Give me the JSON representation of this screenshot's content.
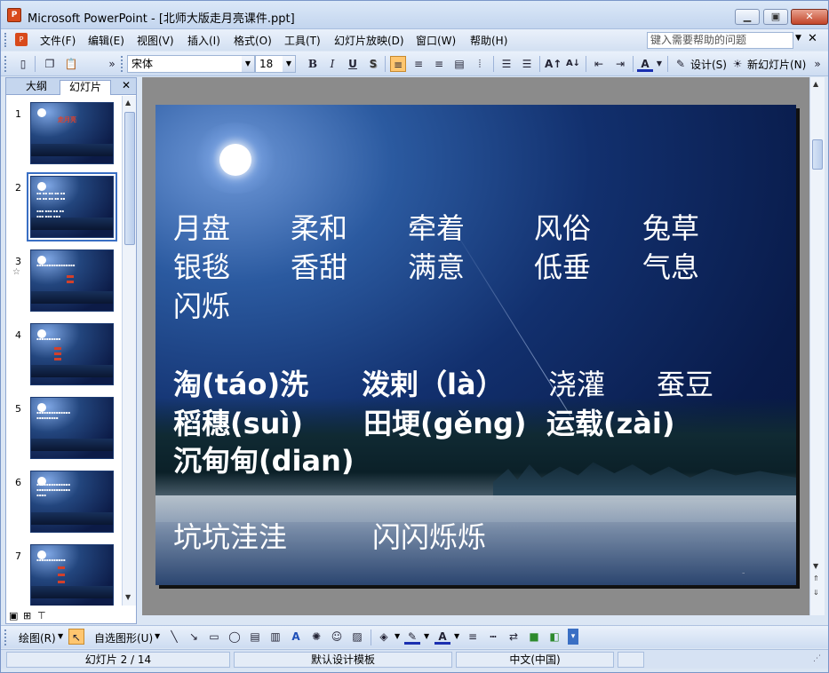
{
  "window": {
    "title": "Microsoft PowerPoint - [北师大版走月亮课件.ppt]",
    "icon": "powerpoint-icon",
    "controls": [
      "minimize-icon",
      "maximize-icon",
      "close-icon"
    ]
  },
  "menu": {
    "items": [
      "文件(F)",
      "编辑(E)",
      "视图(V)",
      "插入(I)",
      "格式(O)",
      "工具(T)",
      "幻灯片放映(D)",
      "窗口(W)",
      "帮助(H)"
    ],
    "help_placeholder": "键入需要帮助的问题"
  },
  "toolbar": {
    "font_name": "宋体",
    "font_size": "18",
    "bold": "B",
    "italic": "I",
    "underline": "U",
    "shadow": "S",
    "design_label": "设计(S)",
    "new_slide_label": "新幻灯片(N)"
  },
  "left_panel": {
    "tabs": [
      "大纲",
      "幻灯片"
    ],
    "active_tab": "幻灯片",
    "thumbnails": [
      {
        "num": "1",
        "title": "走月亮"
      },
      {
        "num": "2"
      },
      {
        "num": "3"
      },
      {
        "num": "4"
      },
      {
        "num": "5"
      },
      {
        "num": "6"
      },
      {
        "num": "7"
      }
    ],
    "selected": "2"
  },
  "slide": {
    "row1": [
      "月盘",
      "柔和",
      "牵着",
      "风俗",
      "兔草"
    ],
    "row2": [
      "银毯",
      "香甜",
      "满意",
      "低垂",
      "气息"
    ],
    "row3": [
      "闪烁"
    ],
    "row4": [
      "淘(táo)洗",
      "泼剌（là）",
      "浇灌",
      "蚕豆"
    ],
    "row5": [
      "稻穗(suì)",
      "田埂(gěng)",
      "运载(zài)"
    ],
    "row6": [
      "沉甸甸(dian)"
    ],
    "row7": [
      "坑坑洼洼",
      "闪闪烁烁"
    ]
  },
  "drawbar": {
    "draw_label": "绘图(R)",
    "autoshape_label": "自选图形(U)"
  },
  "status": {
    "slide_info": "幻灯片 2 / 14",
    "template": "默认设计模板",
    "language": "中文(中国)"
  }
}
